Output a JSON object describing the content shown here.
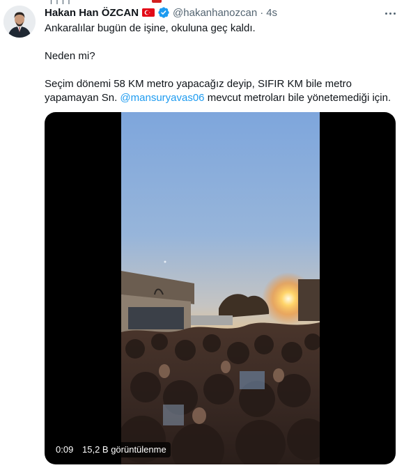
{
  "tweet": {
    "display_name": "Hakan Han ÖZCAN",
    "handle": "@hakanhanozcan",
    "separator": "·",
    "time": "4s",
    "icons": {
      "flag": "turkey-flag-icon",
      "verified": "verified-badge-icon",
      "more": "more-options-icon"
    },
    "text": {
      "line1": "Ankaralılar bugün de işine, okuluna geç kaldı.",
      "line2": "Neden mi?",
      "line3a": "Seçim dönemi 58 KM metro yapacağız deyip, SIFIR KM bile metro",
      "line3b_pre": "yapamayan Sn. ",
      "mention": "@mansuryavas06",
      "line3b_post": " mevcut metroları bile yönetemediği için."
    }
  },
  "video": {
    "duration": "0:09",
    "views": "15,2 B görüntülenme"
  },
  "colors": {
    "accent": "#1d9bf0",
    "text": "#0f1419",
    "muted": "#536471",
    "flag_red": "#e30a17"
  }
}
